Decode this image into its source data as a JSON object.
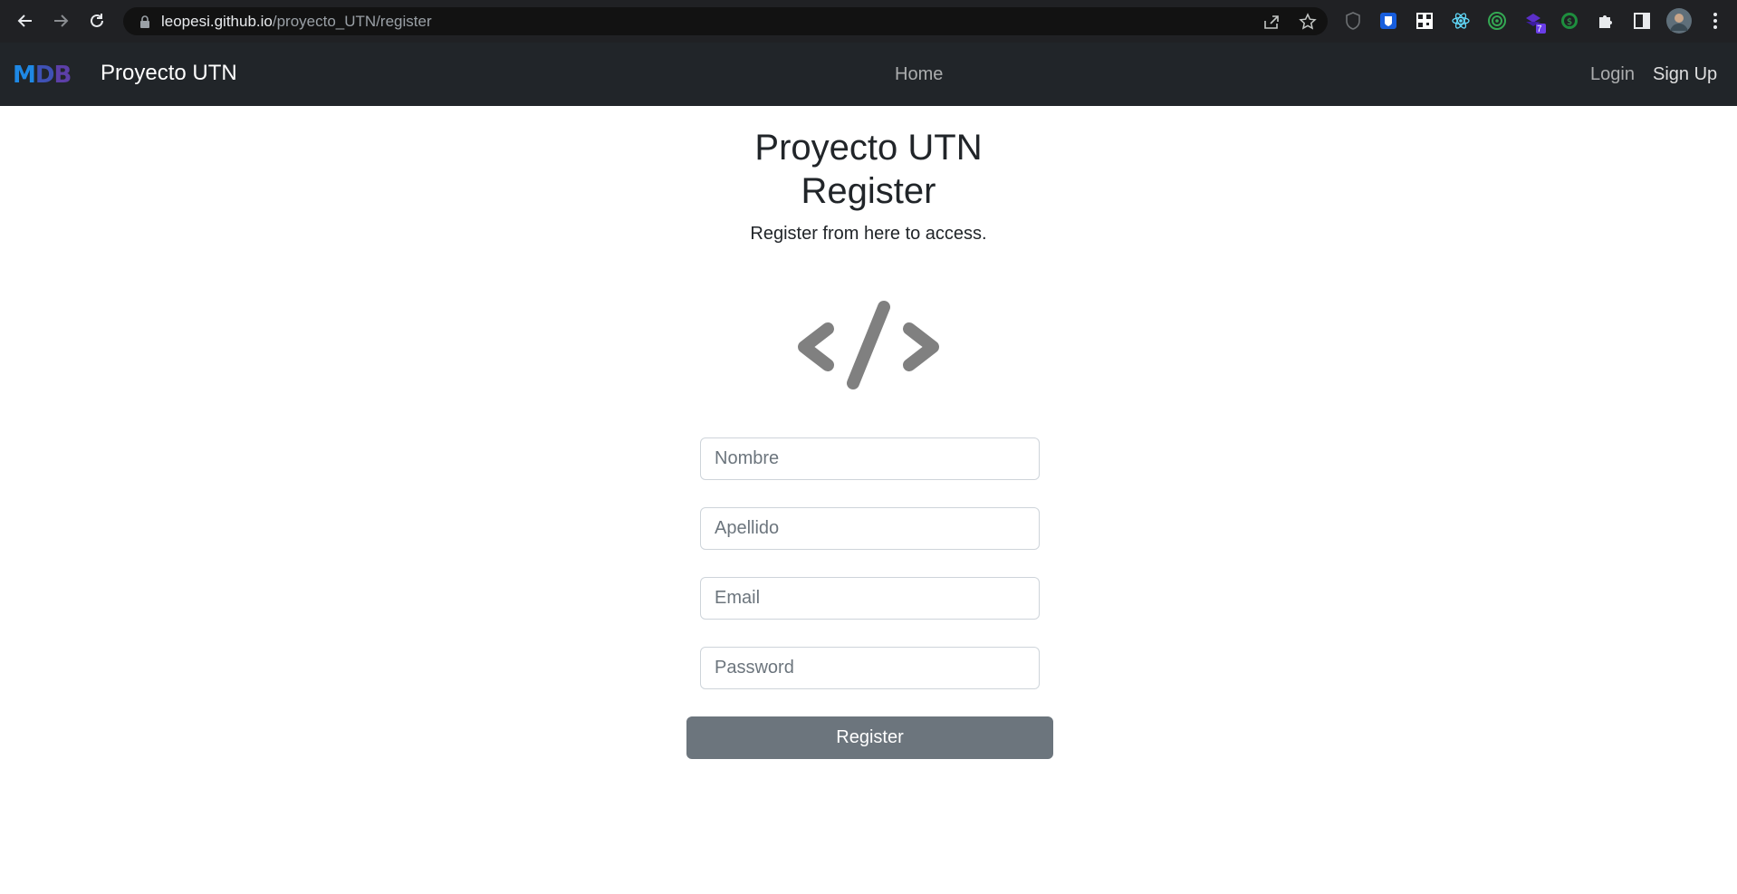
{
  "browser": {
    "url_host": "leopesi.github.io",
    "url_path": "/proyecto_UTN/register",
    "extension_badge": "7"
  },
  "navbar": {
    "logo_letters": [
      "M",
      "D",
      "B"
    ],
    "brand": "Proyecto UTN",
    "home_label": "Home",
    "login_label": "Login",
    "signup_label": "Sign Up"
  },
  "page": {
    "title_line1": "Proyecto UTN",
    "title_line2": "Register",
    "subtitle": "Register from here to access.",
    "icon": "code-icon"
  },
  "form": {
    "nombre_placeholder": "Nombre",
    "apellido_placeholder": "Apellido",
    "email_placeholder": "Email",
    "password_placeholder": "Password",
    "submit_label": "Register"
  },
  "colors": {
    "navbar_bg": "#212529",
    "button_bg": "#6c757d",
    "icon_gray": "#808080"
  }
}
